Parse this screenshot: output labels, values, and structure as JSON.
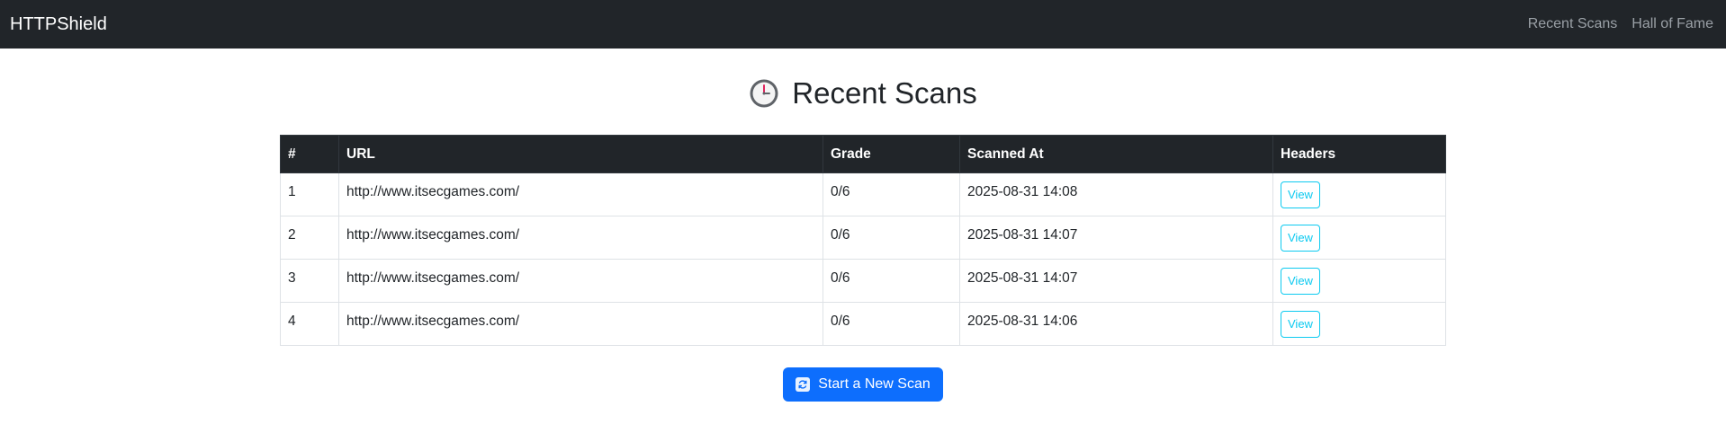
{
  "navbar": {
    "brand": "HTTPShield",
    "links": [
      "Recent Scans",
      "Hall of Fame"
    ]
  },
  "page": {
    "title": "Recent Scans",
    "title_icon": "clock-icon"
  },
  "table": {
    "headers": [
      "#",
      "URL",
      "Grade",
      "Scanned At",
      "Headers"
    ],
    "rows": [
      {
        "num": "1",
        "url": "http://www.itsecgames.com/",
        "grade": "0/6",
        "scanned_at": "2025-08-31 14:08",
        "action": "View"
      },
      {
        "num": "2",
        "url": "http://www.itsecgames.com/",
        "grade": "0/6",
        "scanned_at": "2025-08-31 14:07",
        "action": "View"
      },
      {
        "num": "3",
        "url": "http://www.itsecgames.com/",
        "grade": "0/6",
        "scanned_at": "2025-08-31 14:07",
        "action": "View"
      },
      {
        "num": "4",
        "url": "http://www.itsecgames.com/",
        "grade": "0/6",
        "scanned_at": "2025-08-31 14:06",
        "action": "View"
      }
    ]
  },
  "actions": {
    "new_scan_label": "Start a New Scan",
    "new_scan_icon": "refresh-icon"
  },
  "colors": {
    "navbar_bg": "#212529",
    "primary": "#0d6efd",
    "info": "#0dcaf0"
  }
}
